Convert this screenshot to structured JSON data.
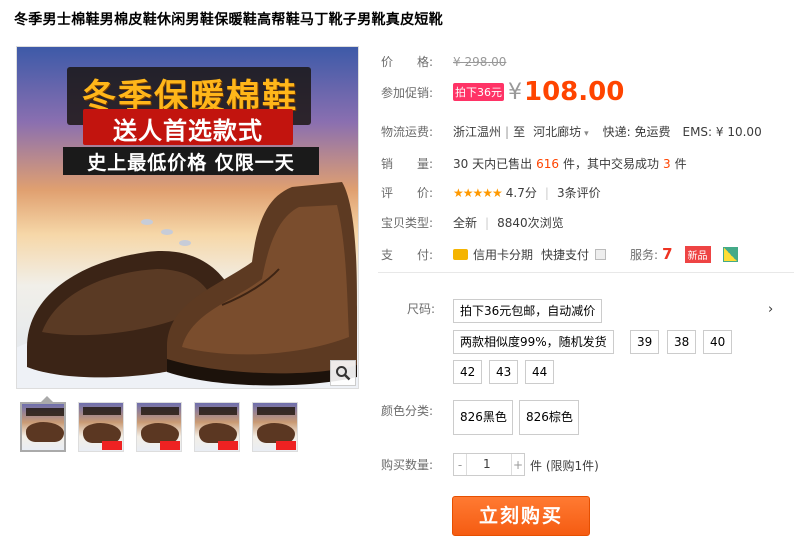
{
  "product": {
    "title": "冬季男士棉鞋男棉皮鞋休闲男鞋保暖鞋高帮鞋马丁靴子男靴真皮短靴"
  },
  "image": {
    "headline": "冬季保暖棉鞋",
    "subhead": "送人首选款式",
    "strip": "史上最低价格 仅限一天",
    "thumb_count": 5
  },
  "price": {
    "label": "价　　格:",
    "original": "¥ 298.00",
    "promo_label": "参加促销:",
    "promo_tag": "拍下36元",
    "yen": "¥",
    "current": "108.00"
  },
  "shipping": {
    "label": "物流运费:",
    "from": "浙江温州",
    "sep": "至",
    "to": "河北廊坊",
    "express": "快递: 免运费",
    "ems": "EMS: ¥ 10.00"
  },
  "sales": {
    "label": "销　　量:",
    "prefix": "30 天内已售出",
    "count": "616",
    "mid": "件，其中交易成功",
    "success": "3",
    "suffix": "件"
  },
  "rating": {
    "label": "评　　价:",
    "stars": "★★★★★",
    "score": "4.7分",
    "reviews": "3条评价"
  },
  "item_type": {
    "label": "宝贝类型:",
    "condition": "全新",
    "views": "8840次浏览"
  },
  "payment": {
    "label": "支　　付:",
    "credit": "信用卡分期",
    "quick": "快捷支付",
    "service_label": "服务:",
    "service_7": "7",
    "new_badge": "新品"
  },
  "sku": {
    "size_label": "尺码:",
    "size_options": [
      "拍下36元包邮，自动减价",
      "两款相似度99%，随机发货",
      "39",
      "38",
      "40",
      "42",
      "43",
      "44"
    ],
    "more": "›",
    "color_label": "颜色分类:",
    "color_options": [
      "826黑色",
      "826棕色"
    ],
    "qty_label": "购买数量:",
    "qty_minus": "-",
    "qty_value": "1",
    "qty_plus": "+",
    "qty_note": "件 (限购1件)"
  },
  "buy": {
    "label": "立刻购买"
  },
  "colors": {
    "accent": "#ff4400",
    "promo_tag": "#ff3366",
    "buy_button": "#f55c12"
  }
}
